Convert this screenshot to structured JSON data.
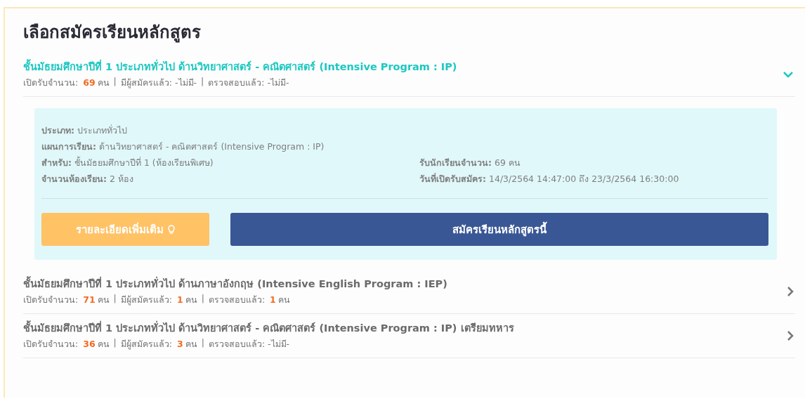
{
  "heading": "เลือกสมัครเรียนหลักสูตร",
  "separator": "|",
  "courses": [
    {
      "title": "ชั้นมัธยมศึกษาปีที่ 1 ประเภททั่วไป ด้านวิทยาศาสตร์ - คณิตศาสตร์ (Intensive Program : IP)",
      "expanded": true,
      "stats": [
        {
          "label": "เปิดรับจำนวน:",
          "value": "69",
          "unit": "คน",
          "highlight": true
        },
        {
          "label": "มีผู้สมัครแล้ว:",
          "value": "-ไม่มี-",
          "highlight": false
        },
        {
          "label": "ตรวจสอบแล้ว:",
          "value": "-ไม่มี-",
          "highlight": false
        }
      ],
      "details": [
        [
          {
            "label": "ประเภท:",
            "value": "ประเภททั่วไป"
          }
        ],
        [
          {
            "label": "แผนการเรียน:",
            "value": "ด้านวิทยาศาสตร์ - คณิตศาสตร์ (Intensive Program : IP)"
          }
        ],
        [
          {
            "label": "สำหรับ:",
            "value": "ชั้นมัธยมศึกษาปีที่ 1 (ห้องเรียนพิเศษ)"
          },
          {
            "label": "รับนักเรียนจำนวน:",
            "value": "69 คน"
          }
        ],
        [
          {
            "label": "จำนวนห้องเรียน:",
            "value": "2 ห้อง"
          },
          {
            "label": "วันที่เปิดรับสมัคร:",
            "value": "14/3/2564 14:47:00 ถึง 23/3/2564 16:30:00"
          }
        ]
      ],
      "buttons": [
        {
          "label": "รายละเอียดเพิ่มเติม",
          "kind": "info"
        },
        {
          "label": "สมัครเรียนหลักสูตรนี้",
          "kind": "apply"
        }
      ]
    },
    {
      "title": "ชั้นมัธยมศึกษาปีที่ 1 ประเภททั่วไป ด้านภาษาอังกฤษ (Intensive English Program : IEP)",
      "expanded": false,
      "stats": [
        {
          "label": "เปิดรับจำนวน:",
          "value": "71",
          "unit": "คน",
          "highlight": true
        },
        {
          "label": "มีผู้สมัครแล้ว:",
          "value": "1",
          "unit": "คน",
          "highlight": true
        },
        {
          "label": "ตรวจสอบแล้ว:",
          "value": "1",
          "unit": "คน",
          "highlight": true
        }
      ]
    },
    {
      "title": "ชั้นมัธยมศึกษาปีที่ 1 ประเภททั่วไป ด้านวิทยาศาสตร์ - คณิตศาสตร์ (Intensive Program : IP) เตรียมทหาร",
      "expanded": false,
      "stats": [
        {
          "label": "เปิดรับจำนวน:",
          "value": "36",
          "unit": "คน",
          "highlight": true
        },
        {
          "label": "มีผู้สมัครแล้ว:",
          "value": "3",
          "unit": "คน",
          "highlight": true
        },
        {
          "label": "ตรวจสอบแล้ว:",
          "value": "-ไม่มี-",
          "highlight": false
        }
      ]
    }
  ]
}
